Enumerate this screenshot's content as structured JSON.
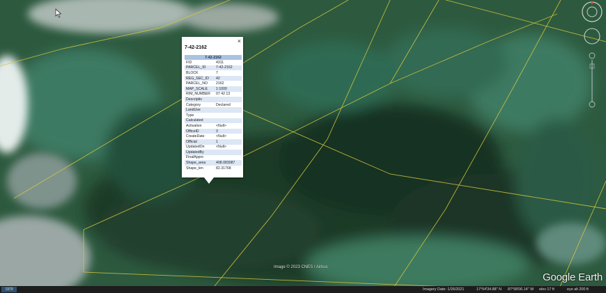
{
  "popup": {
    "title": "7-42-2162",
    "close_glyph": "×",
    "table_header": "7-42-2162",
    "rows": [
      {
        "key": "FID",
        "value": "4311"
      },
      {
        "key": "PARCEL_ID",
        "value": "7-42-2162"
      },
      {
        "key": "BLOCK",
        "value": "7"
      },
      {
        "key": "REG_SEC_ID",
        "value": "42"
      },
      {
        "key": "PARCEL_NO",
        "value": "2162"
      },
      {
        "key": "MAP_SCALE",
        "value": "1:1000"
      },
      {
        "key": "RIM_NUMBER",
        "value": "07 42 13"
      },
      {
        "key": "Descriptio",
        "value": ""
      },
      {
        "key": "Category",
        "value": "Declared"
      },
      {
        "key": "LandUse",
        "value": ""
      },
      {
        "key": "Type",
        "value": ""
      },
      {
        "key": "Calculated",
        "value": ""
      },
      {
        "key": "Activation",
        "value": "<Null>"
      },
      {
        "key": "OfficeID",
        "value": "3"
      },
      {
        "key": "CreateDate",
        "value": "<Null>"
      },
      {
        "key": "Official",
        "value": "1"
      },
      {
        "key": "UpdatedOn",
        "value": "<Null>"
      },
      {
        "key": "UpdatedBy",
        "value": ""
      },
      {
        "key": "FinalAppro",
        "value": ""
      },
      {
        "key": "Shape_area",
        "value": "408.083087"
      },
      {
        "key": "Shape_len",
        "value": "82.31768"
      }
    ]
  },
  "map": {
    "image_credit": "Image © 2023 CNES / Airbus",
    "logo": "Google Earth",
    "parcel_line_color": "#d8c83a"
  },
  "statusbar": {
    "left_badge": "1979",
    "imagery_date": "Imagery Date: 1/26/2021",
    "latitude": "17°54'34.88\" N",
    "longitude": "87°58'06.14\" W",
    "elevation": "elev   17 ft",
    "eye_alt": "eye alt   200 ft"
  },
  "icons": {
    "compass": "compass-icon",
    "look": "look-joystick-icon",
    "move": "move-joystick-icon",
    "zoom_slider": "zoom-slider-icon",
    "cursor": "mouse-cursor-icon"
  }
}
